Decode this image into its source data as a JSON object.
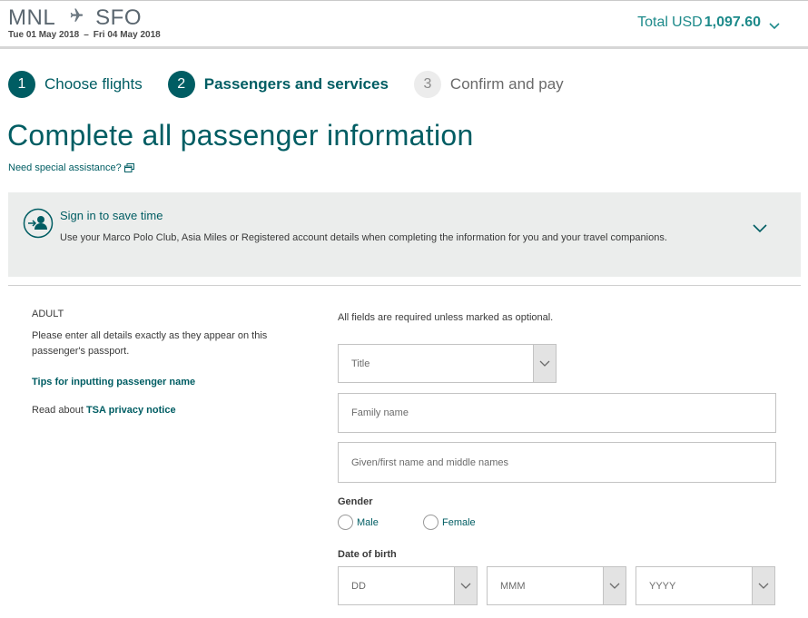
{
  "header": {
    "origin": "MNL",
    "destination": "SFO",
    "depart_date": "Tue 01 May 2018",
    "date_separator": "–",
    "return_date": "Fri 04 May 2018",
    "total_label": "Total",
    "currency": "USD",
    "total_amount": "1,097.60"
  },
  "steps": [
    {
      "number": "1",
      "label": "Choose flights",
      "state": "done"
    },
    {
      "number": "2",
      "label": "Passengers and services",
      "state": "active"
    },
    {
      "number": "3",
      "label": "Confirm and pay",
      "state": "todo"
    }
  ],
  "page_title": "Complete all passenger information",
  "assistance_link": "Need special assistance?",
  "signin": {
    "title": "Sign in to save time",
    "description": "Use your Marco Polo Club, Asia Miles or Registered account details when completing the information for you and your travel companions."
  },
  "passenger": {
    "type": "ADULT",
    "instruction": "Please enter all details exactly as they appear on this passenger's passport.",
    "tips_link": "Tips for inputting passenger name",
    "tsa_prefix": "Read about",
    "tsa_link": "TSA privacy notice"
  },
  "form": {
    "required_note": "All fields are required unless marked as optional.",
    "title_placeholder": "Title",
    "family_name_placeholder": "Family name",
    "given_name_placeholder": "Given/first name and middle names",
    "gender_label": "Gender",
    "gender_options": [
      "Male",
      "Female"
    ],
    "dob_label": "Date of birth",
    "dob_day": "DD",
    "dob_month": "MMM",
    "dob_year": "YYYY"
  },
  "colors": {
    "brand": "#005d63",
    "accent": "#1d8a8a",
    "panel": "#ebedec"
  },
  "icons": {
    "route": "airplane-icon",
    "total": "chevron-down-icon",
    "assist": "external-window-icon",
    "signin": "person-signin-icon"
  }
}
